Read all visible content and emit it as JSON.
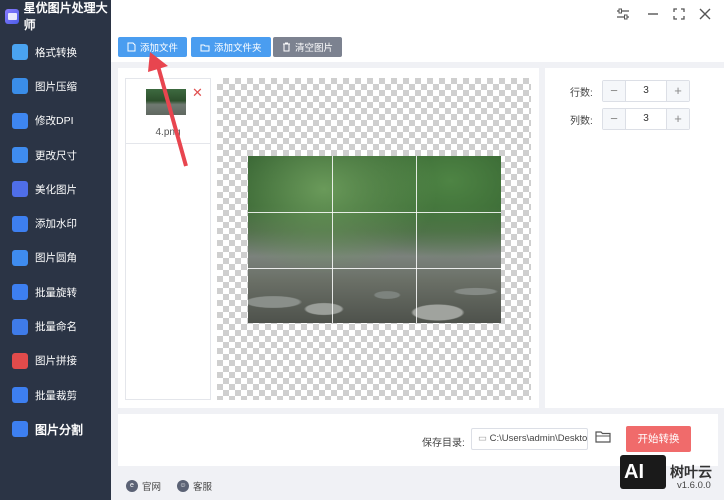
{
  "app": {
    "title": "星优图片处理大师"
  },
  "sidebar": {
    "items": [
      {
        "label": "格式转换",
        "icon": "format-convert-icon",
        "color": "#4aa3f0"
      },
      {
        "label": "图片压缩",
        "icon": "compress-icon",
        "color": "#3a8de8"
      },
      {
        "label": "修改DPI",
        "icon": "dpi-icon",
        "color": "#3e86f0"
      },
      {
        "label": "更改尺寸",
        "icon": "resize-icon",
        "color": "#3f8cef"
      },
      {
        "label": "美化图片",
        "icon": "beautify-icon",
        "color": "#4f6ee8"
      },
      {
        "label": "添加水印",
        "icon": "watermark-icon",
        "color": "#3d7ff0"
      },
      {
        "label": "图片圆角",
        "icon": "rounded-corner-icon",
        "color": "#3f8cef"
      },
      {
        "label": "批量旋转",
        "icon": "rotate-icon",
        "color": "#3d7ff0"
      },
      {
        "label": "批量命名",
        "icon": "rename-icon",
        "color": "#3f7be8"
      },
      {
        "label": "图片拼接",
        "icon": "stitch-icon",
        "color": "#e24b4b"
      },
      {
        "label": "批量裁剪",
        "icon": "crop-icon",
        "color": "#3d7ff0"
      },
      {
        "label": "图片分割",
        "icon": "split-icon",
        "color": "#3d7ff0"
      }
    ],
    "active_index": 11
  },
  "toolbar": {
    "add_file": "添加文件",
    "add_folder": "添加文件夹",
    "clear_images": "清空图片"
  },
  "file_list": {
    "files": [
      {
        "name": "4.png"
      }
    ]
  },
  "settings": {
    "rows_label": "行数:",
    "rows_value": "3",
    "cols_label": "列数:",
    "cols_value": "3"
  },
  "output": {
    "save_label": "保存目录:",
    "save_path": "C:\\Users\\admin\\Deskto",
    "start_button": "开始转换"
  },
  "footer": {
    "website": "官网",
    "support": "客服",
    "version": "v1.6.0.0"
  },
  "watermark": {
    "logo": "AI",
    "text": "树叶云"
  },
  "colors": {
    "sidebar_bg": "#2b3445",
    "accent_blue": "#4a9df0",
    "start_red": "#f06b6b"
  }
}
